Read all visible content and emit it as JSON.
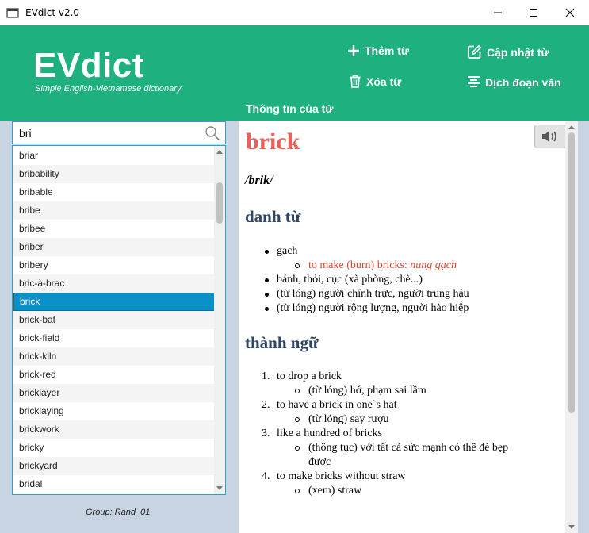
{
  "window": {
    "title": "EVdict v2.0"
  },
  "header": {
    "logo": "EVdict",
    "tagline": "Simple English-Vietnamese dictionary",
    "add_label": "Thêm từ",
    "update_label": "Cập nhật từ",
    "delete_label": "Xóa từ",
    "translate_label": "Dịch đoạn văn",
    "section_title": "Thông tin của từ"
  },
  "search": {
    "value": "bri"
  },
  "wordlist": {
    "items": [
      "briar",
      "bribability",
      "bribable",
      "bribe",
      "bribee",
      "briber",
      "bribery",
      "bric-à-brac",
      "brick",
      "brick-bat",
      "brick-field",
      "brick-kiln",
      "brick-red",
      "bricklayer",
      "bricklaying",
      "brickwork",
      "bricky",
      "brickyard",
      "bridal"
    ],
    "selected": "brick",
    "scroll_fraction": 0.09
  },
  "group": {
    "label": "Group: Rand_01"
  },
  "detail": {
    "word": "brick",
    "pronunciation": "/brik/",
    "noun_heading": "danh từ",
    "noun_items": [
      {
        "text": "gạch",
        "examples": [
          {
            "phrase": "to make (burn) bricks: ",
            "meaning": "nung gạch"
          }
        ]
      },
      {
        "text": "bánh, thỏi, cục (xà phòng, chè...)",
        "examples": []
      },
      {
        "text": "(từ lóng) người chính trực, người trung hậu",
        "examples": []
      },
      {
        "text": "(từ lóng) người rộng lượng, người hào hiệp",
        "examples": []
      }
    ],
    "idiom_heading": "thành ngữ",
    "idioms": [
      {
        "num": "1.",
        "phrase": "to drop a brick",
        "meanings": [
          "(từ lóng) hớ, phạm sai lầm"
        ]
      },
      {
        "num": "2.",
        "phrase": "to have a brick in one`s hat",
        "meanings": [
          "(từ lóng) say rượu"
        ]
      },
      {
        "num": "3.",
        "phrase": "like a hundred of bricks",
        "meanings": [
          "(thông tục) với tất cả sức mạnh có thể đè bẹp",
          "được"
        ]
      },
      {
        "num": "4.",
        "phrase": "to make bricks without straw",
        "meanings": [
          "(xem) straw"
        ]
      }
    ]
  },
  "colors": {
    "accent": "#1fb07f",
    "selection": "#0a90c8",
    "word": "#e8615a",
    "heading": "#2e4566",
    "example": "#d9452e"
  }
}
